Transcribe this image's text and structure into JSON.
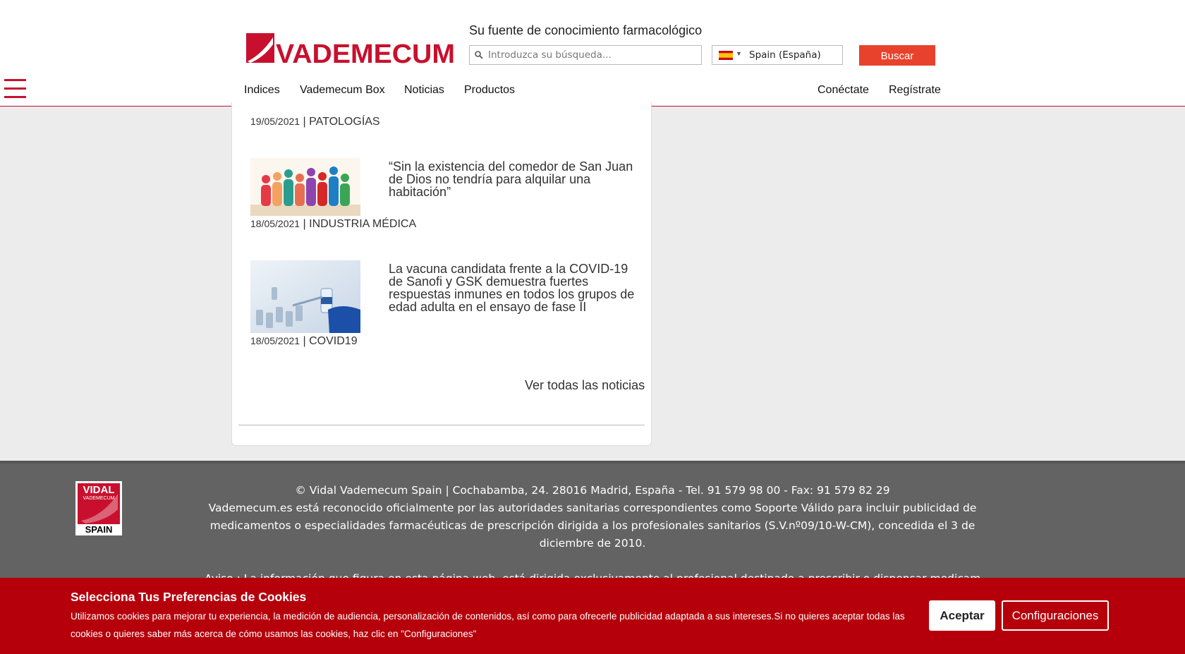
{
  "header": {
    "logo_text": "VADEMECUM",
    "tagline": "Su fuente de conocimiento farmacológico",
    "search_placeholder": "Introduzca su búsqueda...",
    "country": "Spain (España)",
    "search_button": "Buscar",
    "brand_color": "#c8102e"
  },
  "nav": {
    "items": [
      "Indices",
      "Vademecum Box",
      "Noticias",
      "Productos"
    ],
    "right_items": [
      "Conéctate",
      "Regístrate"
    ]
  },
  "news": {
    "first_meta": {
      "date": "19/05/2021",
      "category": "PATOLOGÍAS"
    },
    "items": [
      {
        "title": "“Sin la existencia del comedor de San Juan de Dios no tendría para alquilar una habitación”",
        "date": "18/05/2021",
        "category": "INDUSTRIA MÉDICA",
        "image_icon": "people-group-illustration"
      },
      {
        "title": "La vacuna candidata frente a la COVID-19 de Sanofi y GSK demuestra fuertes respuestas inmunes en todos los grupos de edad adulta en el ensayo de fase II",
        "date": "18/05/2021",
        "category": "COVID19",
        "image_icon": "vaccine-vials-photo"
      }
    ],
    "see_all": "Ver todas las noticias"
  },
  "footer": {
    "logo_text": [
      "VIDAL",
      "VADEMECUM",
      "SPAIN"
    ],
    "address": "© Vidal Vademecum Spain | Cochabamba, 24. 28016 Madrid, España - Tel. 91 579 98 00 - Fax: 91 579 82 29",
    "legal": "Vademecum.es está reconocido oficialmente por las autoridades sanitarias correspondientes como Soporte Válido para incluir publicidad de medicamentos o especialidades farmacéuticas de prescripción dirigida a los profesionales sanitarios (S.V.nº09/10-W-CM), concedida el 3 de diciembre de 2010.",
    "aviso": "Aviso : La información que figura en esta página web, está dirigida exclusivamente al profesional destinado a prescribir o dispensar medicamentos por"
  },
  "cookie_banner": {
    "title": "Selecciona Tus Preferencias de Cookies",
    "text": "Utilizamos cookies para mejorar tu experiencia, la medición de audiencia, personalización de contenidos, así como para ofrecerle publicidad adaptada a sus intereses.Si no quieres aceptar todas las cookies o quieres saber más acerca de cómo usamos las cookies, haz clic en \"Configuraciones\"",
    "accept": "Aceptar",
    "settings": "Configuraciones",
    "background_color": "#b5000b"
  }
}
